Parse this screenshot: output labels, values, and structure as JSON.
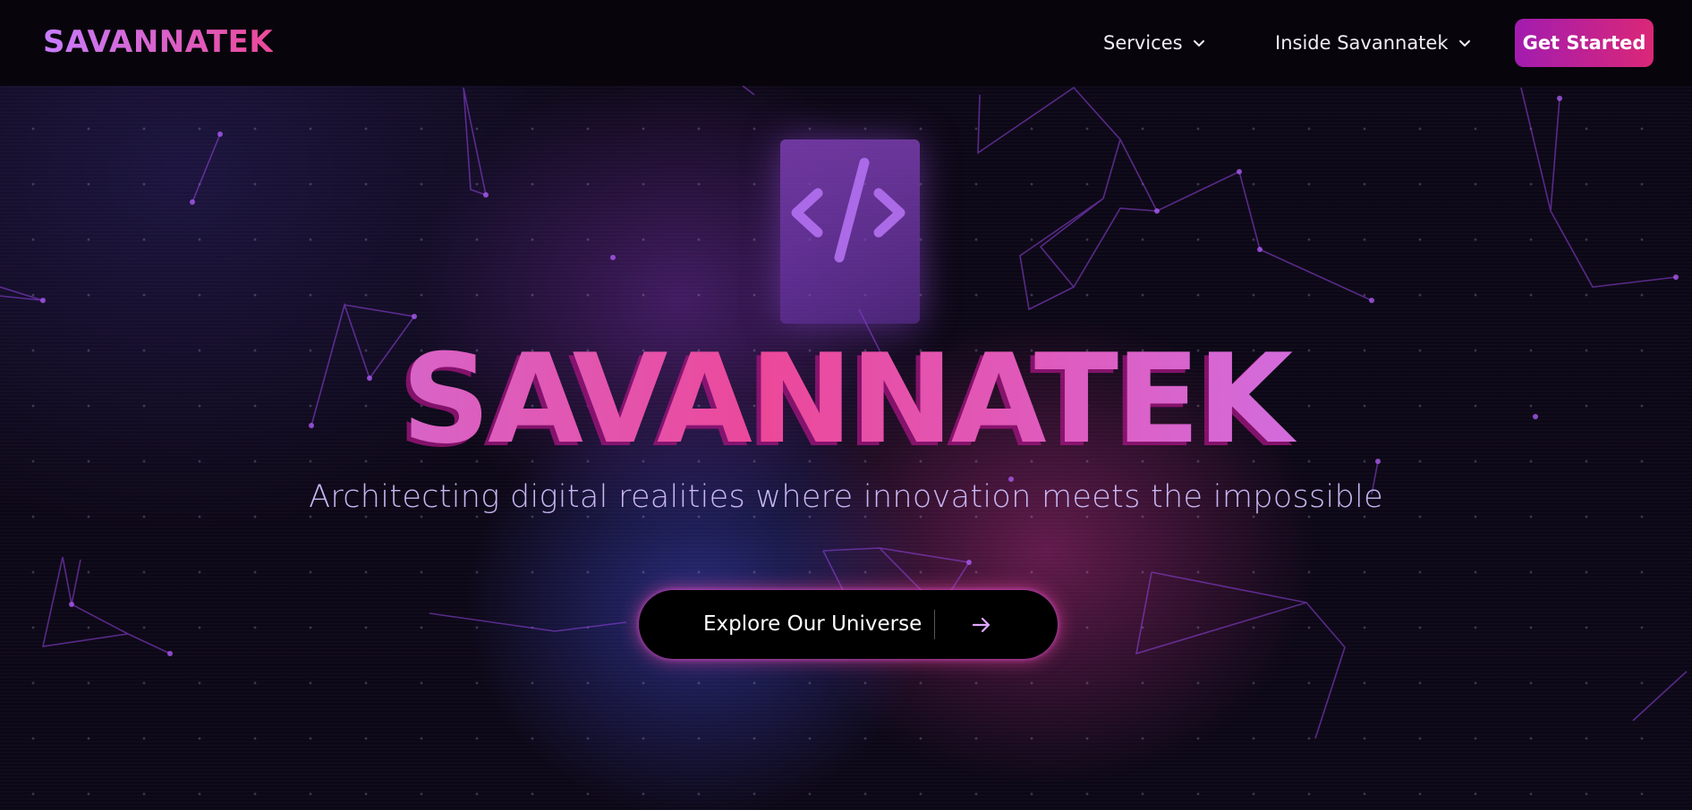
{
  "nav": {
    "logo": "SAVANNATEK",
    "items": [
      {
        "label": "Services",
        "icon": "chevron-down-icon"
      },
      {
        "label": "Inside Savannatek",
        "icon": "chevron-down-icon"
      }
    ],
    "cta_label": "Get Started"
  },
  "hero": {
    "icon": "code-icon",
    "title": "SAVANNATEK",
    "subtitle": "Architecting digital realities where innovation meets the impossible",
    "button_label": "Explore Our Universe",
    "button_icon": "arrow-right-icon"
  },
  "colors": {
    "background": "#0b0712",
    "accent_purple": "#c084fc",
    "accent_pink": "#ec4899",
    "cta_gradient_start": "#a21caf",
    "cta_gradient_end": "#db2777"
  }
}
